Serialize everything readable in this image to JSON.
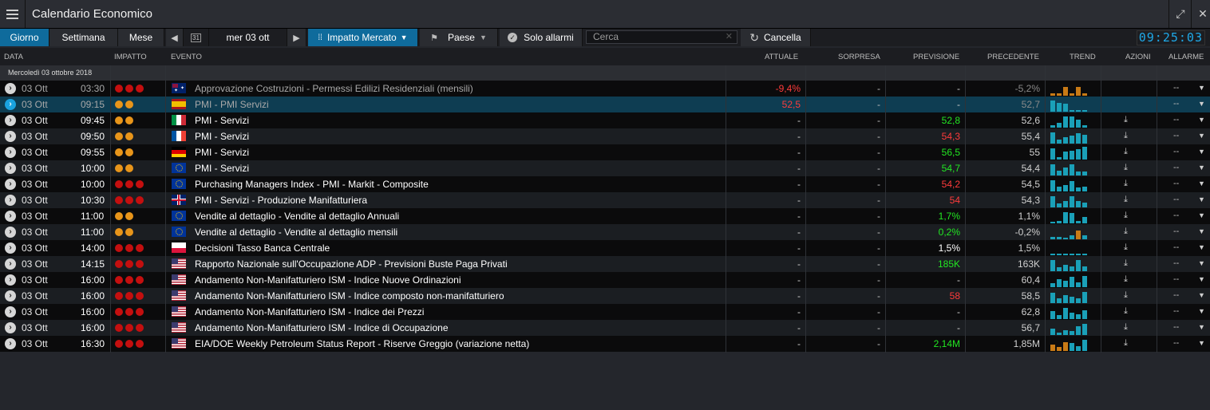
{
  "app": {
    "title": "Calendario Economico",
    "clock": "09:25:03"
  },
  "toolbar": {
    "giorno": "Giorno",
    "settimana": "Settimana",
    "mese": "Mese",
    "date": "mer 03 ott",
    "calendar_day": "31",
    "impatto": "Impatto Mercato",
    "paese": "Paese",
    "solo_allarmi": "Solo allarmi",
    "search_placeholder": "Cerca",
    "cancella": "Cancella"
  },
  "columns": {
    "data": "DATA",
    "impatto": "IMPATTO",
    "evento": "EVENTO",
    "attuale": "ATTUALE",
    "sorpresa": "SORPRESA",
    "previsione": "PREVISIONE",
    "precedente": "PRECEDENTE",
    "trend": "TREND",
    "azioni": "AZIONI",
    "allarme": "ALLARME"
  },
  "date_separator": "Mercoledì 03 ottobre 2018",
  "colors": {
    "red": "#c40f0f",
    "orange": "#e8951a",
    "green": "#22e622",
    "redtext": "#ff3b3b",
    "accent": "#0f6b9c",
    "trend_blue": "#1aa0b8",
    "trend_orange": "#c87a16"
  },
  "rows": [
    {
      "date": "03 Ott",
      "time": "03:30",
      "impact": 3,
      "flag": "au",
      "event": "Approvazione Costruzioni - Permessi Edilizi Residenziali (mensili)",
      "actual": "-9,4%",
      "actual_color": "red",
      "surprise": "-",
      "forecast": "-",
      "forecast_color": "",
      "previous": "-5,2%",
      "trend": [
        0.2,
        0.2,
        0.7,
        0.2,
        0.7,
        0.2
      ],
      "trend_color": "orange",
      "download": false,
      "alarm": "--",
      "dim": true,
      "highlight": false
    },
    {
      "date": "03 Ott",
      "time": "09:15",
      "impact": 2,
      "flag": "es",
      "event": "PMI - PMI Servizi",
      "actual": "52,5",
      "actual_color": "red",
      "surprise": "-",
      "forecast": "-",
      "forecast_color": "",
      "previous": "52,7",
      "trend": [
        0.9,
        0.7,
        0.6,
        0.1,
        0.1,
        0.1
      ],
      "trend_color": "blue",
      "download": false,
      "alarm": "--",
      "dim": true,
      "highlight": true
    },
    {
      "date": "03 Ott",
      "time": "09:45",
      "impact": 2,
      "flag": "it",
      "event": "PMI - Servizi",
      "actual": "-",
      "actual_color": "",
      "surprise": "-",
      "forecast": "52,8",
      "forecast_color": "green",
      "previous": "52,6",
      "trend": [
        0.2,
        0.4,
        0.9,
        0.9,
        0.6,
        0.2
      ],
      "trend_color": "blue",
      "download": true,
      "alarm": "--",
      "dim": false,
      "highlight": false
    },
    {
      "date": "03 Ott",
      "time": "09:50",
      "impact": 2,
      "flag": "fr",
      "event": "PMI - Servizi",
      "actual": "-",
      "actual_color": "",
      "surprise": "-",
      "forecast": "54,3",
      "forecast_color": "red",
      "previous": "55,4",
      "trend": [
        0.9,
        0.3,
        0.5,
        0.6,
        0.8,
        0.7
      ],
      "trend_color": "blue",
      "download": true,
      "alarm": "--",
      "dim": false,
      "highlight": false
    },
    {
      "date": "03 Ott",
      "time": "09:55",
      "impact": 2,
      "flag": "de",
      "event": "PMI - Servizi",
      "actual": "-",
      "actual_color": "",
      "surprise": "-",
      "forecast": "56,5",
      "forecast_color": "green",
      "previous": "55",
      "trend": [
        0.9,
        0.2,
        0.6,
        0.7,
        0.8,
        1.0
      ],
      "trend_color": "blue",
      "download": true,
      "alarm": "--",
      "dim": false,
      "highlight": false
    },
    {
      "date": "03 Ott",
      "time": "10:00",
      "impact": 2,
      "flag": "eu",
      "event": "PMI - Servizi",
      "actual": "-",
      "actual_color": "",
      "surprise": "-",
      "forecast": "54,7",
      "forecast_color": "green",
      "previous": "54,4",
      "trend": [
        0.9,
        0.4,
        0.6,
        0.9,
        0.3,
        0.3
      ],
      "trend_color": "blue",
      "download": true,
      "alarm": "--",
      "dim": false,
      "highlight": false
    },
    {
      "date": "03 Ott",
      "time": "10:00",
      "impact": 3,
      "flag": "eu",
      "event": "Purchasing Managers Index - PMI - Markit - Composite",
      "actual": "-",
      "actual_color": "",
      "surprise": "-",
      "forecast": "54,2",
      "forecast_color": "red",
      "previous": "54,5",
      "trend": [
        0.9,
        0.4,
        0.5,
        0.8,
        0.3,
        0.4
      ],
      "trend_color": "blue",
      "download": true,
      "alarm": "--",
      "dim": false,
      "highlight": false
    },
    {
      "date": "03 Ott",
      "time": "10:30",
      "impact": 3,
      "flag": "gb",
      "event": "PMI - Servizi - Produzione Manifatturiera",
      "actual": "-",
      "actual_color": "",
      "surprise": "-",
      "forecast": "54",
      "forecast_color": "red",
      "previous": "54,3",
      "trend": [
        0.9,
        0.3,
        0.5,
        0.9,
        0.5,
        0.4
      ],
      "trend_color": "blue",
      "download": true,
      "alarm": "--",
      "dim": false,
      "highlight": false
    },
    {
      "date": "03 Ott",
      "time": "11:00",
      "impact": 2,
      "flag": "eu",
      "event": "Vendite al dettaglio - Vendite al dettaglio Annuali",
      "actual": "-",
      "actual_color": "",
      "surprise": "-",
      "forecast": "1,7%",
      "forecast_color": "green",
      "previous": "1,1%",
      "trend": [
        0.1,
        0.2,
        0.9,
        0.8,
        0.2,
        0.5
      ],
      "trend_color": "blue",
      "download": true,
      "alarm": "--",
      "dim": false,
      "highlight": false
    },
    {
      "date": "03 Ott",
      "time": "11:00",
      "impact": 2,
      "flag": "eu",
      "event": "Vendite al dettaglio - Vendite al dettaglio mensili",
      "actual": "-",
      "actual_color": "",
      "surprise": "-",
      "forecast": "0,2%",
      "forecast_color": "green",
      "previous": "-0,2%",
      "trend": [
        0.2,
        0.2,
        0.1,
        0.3,
        0.7,
        0.3
      ],
      "trend_color": "mixed",
      "download": true,
      "alarm": "--",
      "dim": false,
      "highlight": false
    },
    {
      "date": "03 Ott",
      "time": "14:00",
      "impact": 3,
      "flag": "pl",
      "event": "Decisioni Tasso Banca Centrale",
      "actual": "-",
      "actual_color": "",
      "surprise": "-",
      "forecast": "1,5%",
      "forecast_color": "white",
      "previous": "1,5%",
      "trend": [
        0.1,
        0.1,
        0.1,
        0.1,
        0.1,
        0.1
      ],
      "trend_color": "blue",
      "download": true,
      "alarm": "--",
      "dim": false,
      "highlight": false
    },
    {
      "date": "03 Ott",
      "time": "14:15",
      "impact": 3,
      "flag": "us",
      "event": "Rapporto Nazionale sull'Occupazione ADP - Previsioni Buste Paga Privati",
      "actual": "-",
      "actual_color": "",
      "surprise": "-",
      "forecast": "185K",
      "forecast_color": "green",
      "previous": "163K",
      "trend": [
        0.9,
        0.3,
        0.5,
        0.4,
        0.9,
        0.4
      ],
      "trend_color": "blue",
      "download": true,
      "alarm": "--",
      "dim": false,
      "highlight": false
    },
    {
      "date": "03 Ott",
      "time": "16:00",
      "impact": 3,
      "flag": "us",
      "event": "Andamento Non-Manifatturiero ISM - Indice Nuove Ordinazioni",
      "actual": "-",
      "actual_color": "",
      "surprise": "-",
      "forecast": "-",
      "forecast_color": "",
      "previous": "60,4",
      "trend": [
        0.3,
        0.6,
        0.5,
        0.8,
        0.4,
        0.9
      ],
      "trend_color": "blue",
      "download": true,
      "alarm": "--",
      "dim": false,
      "highlight": false
    },
    {
      "date": "03 Ott",
      "time": "16:00",
      "impact": 3,
      "flag": "us",
      "event": "Andamento Non-Manifatturiero ISM - Indice composto non-manifatturiero",
      "actual": "-",
      "actual_color": "",
      "surprise": "-",
      "forecast": "58",
      "forecast_color": "red",
      "previous": "58,5",
      "trend": [
        0.8,
        0.4,
        0.6,
        0.5,
        0.4,
        0.9
      ],
      "trend_color": "blue",
      "download": true,
      "alarm": "--",
      "dim": false,
      "highlight": false
    },
    {
      "date": "03 Ott",
      "time": "16:00",
      "impact": 3,
      "flag": "us",
      "event": "Andamento Non-Manifatturiero ISM - Indice dei Prezzi",
      "actual": "-",
      "actual_color": "",
      "surprise": "-",
      "forecast": "-",
      "forecast_color": "",
      "previous": "62,8",
      "trend": [
        0.6,
        0.3,
        0.9,
        0.5,
        0.4,
        0.7
      ],
      "trend_color": "blue",
      "download": true,
      "alarm": "--",
      "dim": false,
      "highlight": false
    },
    {
      "date": "03 Ott",
      "time": "16:00",
      "impact": 3,
      "flag": "us",
      "event": "Andamento Non-Manifatturiero ISM - Indice di Occupazione",
      "actual": "-",
      "actual_color": "",
      "surprise": "-",
      "forecast": "-",
      "forecast_color": "",
      "previous": "56,7",
      "trend": [
        0.5,
        0.2,
        0.4,
        0.3,
        0.7,
        0.9
      ],
      "trend_color": "blue",
      "download": true,
      "alarm": "--",
      "dim": false,
      "highlight": false
    },
    {
      "date": "03 Ott",
      "time": "16:30",
      "impact": 3,
      "flag": "us",
      "event": "EIA/DOE Weekly Petroleum Status Report - Riserve Greggio (variazione netta)",
      "actual": "-",
      "actual_color": "",
      "surprise": "-",
      "forecast": "2,14M",
      "forecast_color": "green",
      "previous": "1,85M",
      "trend": [
        0.5,
        0.3,
        0.7,
        0.6,
        0.4,
        0.9
      ],
      "trend_color": "mixed2",
      "download": true,
      "alarm": "--",
      "dim": false,
      "highlight": false
    }
  ]
}
